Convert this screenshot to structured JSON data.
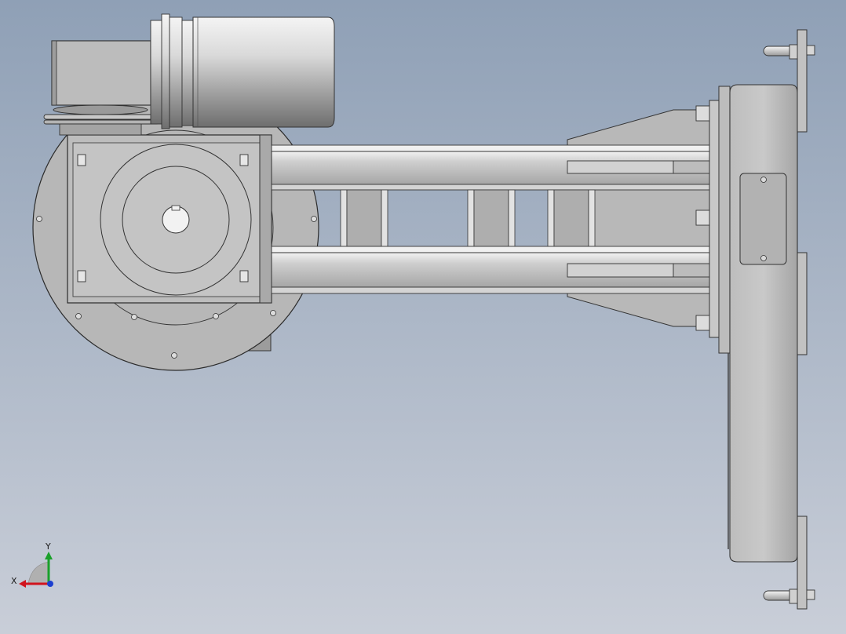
{
  "view": {
    "background_top": "#8fa0b6",
    "background_bottom": "#c9ced8"
  },
  "triad": {
    "x_label": "X",
    "y_label": "Y",
    "x_color": "#d0141e",
    "y_color": "#1aa02a",
    "z_color": "#1c3fd0"
  },
  "model": {
    "parts": [
      "gear-motor",
      "motor-housing",
      "rotary-disk",
      "mounting-plate",
      "upper-rail",
      "lower-rail",
      "frame-cross-bars",
      "carriage-plate",
      "vertical-rail",
      "gripper-pins"
    ]
  }
}
